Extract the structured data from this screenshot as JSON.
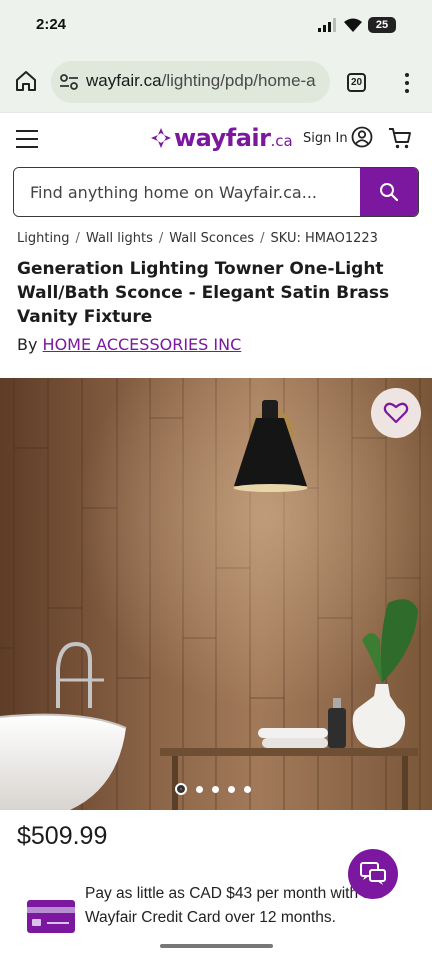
{
  "status": {
    "time": "2:24",
    "battery": "25"
  },
  "browser": {
    "url_host": "wayfair.ca",
    "url_path": "/lighting/pdp/home-a",
    "tab_count": "20"
  },
  "header": {
    "logo_word": "wayfair",
    "logo_tld": ".ca",
    "signin_label": "Sign In"
  },
  "search": {
    "placeholder": "Find anything home on Wayfair.ca..."
  },
  "breadcrumb": {
    "items": [
      "Lighting",
      "Wall lights",
      "Wall Sconces"
    ],
    "sku": "SKU: HMAO1223",
    "separator": "/"
  },
  "product": {
    "title": "Generation Lighting Towner One-Light Wall/Bath Sconce - Elegant Satin Brass Vanity Fixture",
    "by_label": "By",
    "brand": "HOME ACCESSORIES INC",
    "price": "$509.99",
    "gallery_count": 5,
    "gallery_active": 1
  },
  "credit": {
    "text": "Pay as little as CAD $43 per month with the Wayfair Credit Card over 12 months."
  },
  "colors": {
    "brand": "#7b189f",
    "browser_bg": "#eef2ec",
    "url_bg": "#dfe8db"
  },
  "icons": {
    "home": "home-icon",
    "tune": "site-settings-icon",
    "tabs": "tabs-icon",
    "menu": "more-vert-icon",
    "hamburger": "hamburger-icon",
    "user": "user-icon",
    "cart": "cart-icon",
    "search": "search-icon",
    "favorite": "heart-icon",
    "chat": "chat-icon",
    "credit_card": "credit-card-icon"
  }
}
